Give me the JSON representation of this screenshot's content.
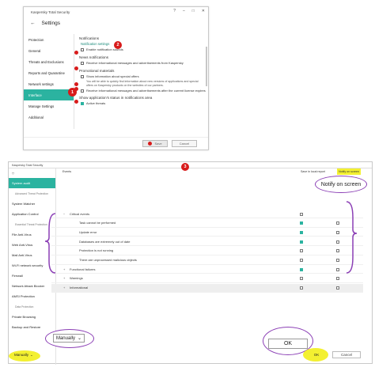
{
  "top_window": {
    "title": "Kaspersky Total Security",
    "window_controls": [
      "?",
      "–",
      "□",
      "✕"
    ],
    "header": {
      "back": "←",
      "title": "Settings"
    },
    "sidebar": [
      "Protection",
      "General",
      "Threats and Exclusions",
      "Reports and Quarantine",
      "Network settings",
      "Interface",
      "Manage Settings",
      "Additional"
    ],
    "selected_index": 5,
    "sections": {
      "notifications": "Notifications",
      "notification_settings_link": "Notification settings",
      "enable_sounds": "Enable notification sounds",
      "news": "News notifications",
      "receive_info": "Receive informational messages and advertisements from Kaspersky",
      "promo": "Promotional materials",
      "special_offers": "Show information about special offers",
      "special_offers_note": "You will be able to quickly find information about new versions of applications and special offers on Kaspersky products on the websites of our partners.",
      "receive_info_expiry": "Receive informational messages and advertisements after the current license expires",
      "status": "Show application's status in notifications area",
      "active_threats": "Active threats"
    },
    "buttons": {
      "save": "Save",
      "cancel": "Cancel"
    },
    "badge_1": "1",
    "badge_2": "2"
  },
  "bottom_window": {
    "title": "Kaspersky Total Security",
    "badge_3": "3",
    "sidebar": [
      {
        "label": "System audit",
        "sel": true,
        "sub": false
      },
      {
        "label": "Advanced Threat Protection",
        "sel": false,
        "sub": true
      },
      {
        "label": "System Watcher",
        "sel": false,
        "sub": false
      },
      {
        "label": "Application Control",
        "sel": false,
        "sub": false
      },
      {
        "label": "Essential Threat Protection",
        "sel": false,
        "sub": true
      },
      {
        "label": "File Anti-Virus",
        "sel": false,
        "sub": false
      },
      {
        "label": "Web Anti-Virus",
        "sel": false,
        "sub": false
      },
      {
        "label": "Mail Anti-Virus",
        "sel": false,
        "sub": false
      },
      {
        "label": "Wi-Fi network security",
        "sel": false,
        "sub": false
      },
      {
        "label": "Firewall",
        "sel": false,
        "sub": false
      },
      {
        "label": "Network Attack Blocker",
        "sel": false,
        "sub": false
      },
      {
        "label": "AMSI Protection",
        "sel": false,
        "sub": false
      },
      {
        "label": "Data Protection",
        "sel": false,
        "sub": true
      },
      {
        "label": "Private Browsing",
        "sel": false,
        "sub": false
      },
      {
        "label": "Backup and Restore",
        "sel": false,
        "sub": false
      }
    ],
    "columns": {
      "events": "Events",
      "save_report": "Save in local report",
      "notify": "Notify on screen"
    },
    "zoom_notify": "Notify on screen",
    "rows": [
      {
        "label": "Critical events",
        "indent": 0,
        "expander": "−",
        "save": false,
        "notify": null
      },
      {
        "label": "Task cannot be performed",
        "indent": 1,
        "expander": "",
        "save": true,
        "notify": false
      },
      {
        "label": "Update error",
        "indent": 1,
        "expander": "",
        "save": true,
        "notify": false
      },
      {
        "label": "Databases are extremely out of date",
        "indent": 1,
        "expander": "",
        "save": true,
        "notify": false
      },
      {
        "label": "Protection is not running",
        "indent": 1,
        "expander": "",
        "save": false,
        "notify": false
      },
      {
        "label": "There are unprocessed malicious objects",
        "indent": 1,
        "expander": "",
        "save": false,
        "notify": false
      },
      {
        "label": "Functional failures",
        "indent": 0,
        "expander": "+",
        "save": true,
        "notify": false
      },
      {
        "label": "Warnings",
        "indent": 0,
        "expander": "+",
        "save": false,
        "notify": false
      },
      {
        "label": "Informational",
        "indent": 0,
        "expander": "+",
        "save": false,
        "notify": false
      }
    ],
    "manually_small": "Manually",
    "manually_zoom": "Manually",
    "ok_small": "OK",
    "ok_zoom": "OK",
    "cancel": "Cancel"
  }
}
